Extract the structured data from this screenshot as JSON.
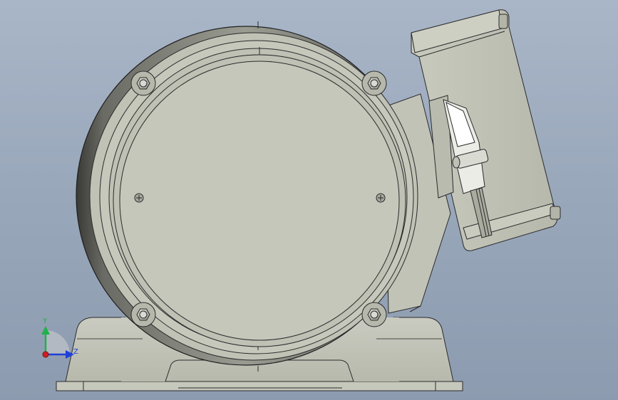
{
  "view": {
    "background_top": "#a9b6c8",
    "background_bottom": "#8d9bb0",
    "part_color": "#c3c5b9",
    "edge_color": "#2b2b2b"
  },
  "triad": {
    "y_label": "Y",
    "z_label": "Z",
    "y_color": "#22b04a",
    "z_color": "#1f3fd8",
    "x_color": "#d02020"
  }
}
